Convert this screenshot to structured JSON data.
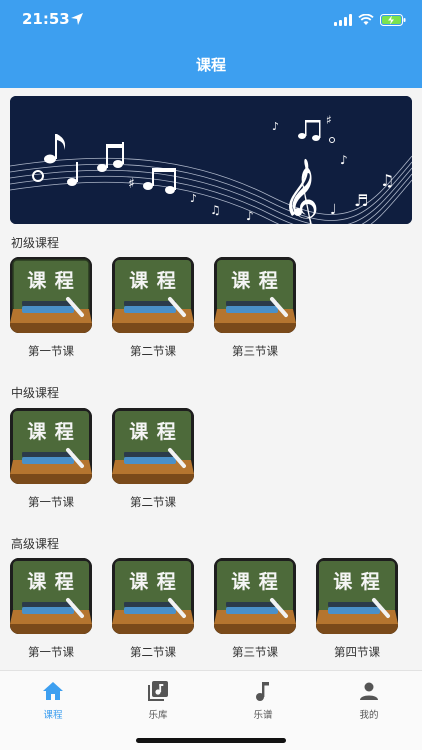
{
  "status": {
    "time": "21:53"
  },
  "header": {
    "title": "课程"
  },
  "sections": [
    {
      "title": "初级课程",
      "lessons": [
        {
          "icon_text": "课 程",
          "label": "第一节课"
        },
        {
          "icon_text": "课 程",
          "label": "第二节课"
        },
        {
          "icon_text": "课 程",
          "label": "第三节课"
        }
      ]
    },
    {
      "title": "中级课程",
      "lessons": [
        {
          "icon_text": "课 程",
          "label": "第一节课"
        },
        {
          "icon_text": "课 程",
          "label": "第二节课"
        }
      ]
    },
    {
      "title": "高级课程",
      "lessons": [
        {
          "icon_text": "课 程",
          "label": "第一节课"
        },
        {
          "icon_text": "课 程",
          "label": "第二节课"
        },
        {
          "icon_text": "课 程",
          "label": "第三节课"
        },
        {
          "icon_text": "课 程",
          "label": "第四节课"
        }
      ]
    }
  ],
  "tabbar": {
    "items": [
      {
        "label": "课程",
        "icon": "home-icon",
        "active": true
      },
      {
        "label": "乐库",
        "icon": "music-library-icon",
        "active": false
      },
      {
        "label": "乐谱",
        "icon": "music-note-icon",
        "active": false
      },
      {
        "label": "我的",
        "icon": "person-icon",
        "active": false
      }
    ]
  },
  "colors": {
    "accent": "#3d9ff0",
    "banner_bg": "#0f1e3f",
    "chalkboard": "#4d6a3a"
  }
}
